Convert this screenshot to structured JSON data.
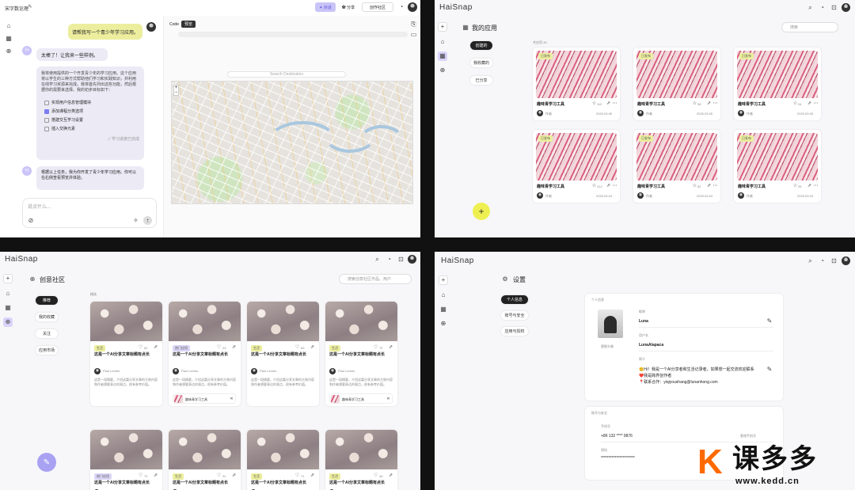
{
  "q1": {
    "title": "宋字数论理",
    "btn_active": "✦ 对话",
    "btn_share": "✿ 分享",
    "btn_community": "创作社区",
    "user_msg": "请帮我写一个青少年学习应用。",
    "bot_msg1": "太棒了！让我来一些样例。",
    "bot_para": "我将使用提供的一个开发青少年的学习应用。这个应用将以学生的三种方式帮助他们学习和实践知识，并利用在线学习资源来完成。我将首先列出这些功能，然后根据你的需要来选择。我的初步目标如下：",
    "tasks": [
      {
        "label": "实现用户信息管理模块",
        "done": false
      },
      {
        "label": "添加课程分类选项",
        "done": true
      },
      {
        "label": "搭建交互学习设置",
        "done": false
      },
      {
        "label": "插入交换元素",
        "done": false
      }
    ],
    "status": "✓ 学习进度已完成",
    "bot_msg2": "根据以上任务，我为你开发了青少年学习应用。你可以在右侧查看预览并体验。",
    "input_placeholder": "说点什么...",
    "tab_code": "Code",
    "tab_preview": "预览",
    "map_search": "Search Destination"
  },
  "q2": {
    "logo": "HaiSnap",
    "page_title": "我的应用",
    "search_placeholder": "搜索",
    "nav": [
      "创建的",
      "我收藏的",
      "已分享"
    ],
    "count_label": "共应用 45",
    "cards": [
      {
        "name": "趣味青学习工具",
        "tag": "已发布",
        "author": "作者",
        "likes": "112",
        "date": "2025.03.05"
      },
      {
        "name": "趣味青学习工具",
        "tag": "已发布",
        "author": "作者",
        "likes": "38",
        "date": "2025.03.05"
      },
      {
        "name": "趣味青学习工具",
        "tag": "已发布",
        "author": "作者",
        "likes": "24",
        "date": "2025.03.05"
      },
      {
        "name": "趣味青学习工具",
        "tag": "已发布",
        "author": "作者",
        "likes": "212",
        "date": "2025.03.04"
      },
      {
        "name": "趣味青学习工具",
        "tag": "已发布",
        "author": "作者",
        "likes": "82",
        "date": "2025.03.04"
      },
      {
        "name": "趣味青学习工具",
        "tag": "已发布",
        "author": "作者",
        "likes": "26",
        "date": "2025.03.03"
      }
    ],
    "fab": "+"
  },
  "q3": {
    "logo": "HaiSnap",
    "page_title": "创意社区",
    "search_placeholder": "搜索创意社区作品、用户",
    "nav": [
      "推荐",
      "我的收藏",
      "关注",
      "应用市场"
    ],
    "section": "精选",
    "posts": [
      {
        "tag": "生活",
        "title": "这是一个AI分享文章标题有点长",
        "author": "Paul Lemiro",
        "likes": "52",
        "body": "这是一段摘要，介绍这篇分享文章的大致内容和作者想要表达的观点，很有参考价值。",
        "app": ""
      },
      {
        "tag": "热门应用",
        "title": "这是一个AI分享文章标题有点长",
        "author": "Paul Lemiro",
        "likes": "23",
        "body": "这是一段摘要，介绍这篇分享文章的大致内容和作者想要表达的观点，很有参考价值。",
        "app": "趣味青学习工具"
      },
      {
        "tag": "生活",
        "title": "这是一个AI分享文章标题有点长",
        "author": "Paul Lemiro",
        "likes": "83",
        "body": "这是一段摘要，介绍这篇分享文章的大致内容和作者想要表达的观点，很有参考价值。",
        "app": ""
      },
      {
        "tag": "生活",
        "title": "这是一个AI分享文章标题有点长",
        "author": "Paul Lemiro",
        "likes": "72",
        "body": "这是一段摘要，介绍这篇分享文章的大致内容和作者想要表达的观点，很有参考价值。",
        "app": "趣味青学习工具"
      },
      {
        "tag": "热门应用",
        "title": "这是一个AI分享文章标题有点长",
        "author": "Paul Lemiro",
        "likes": "70",
        "body": "",
        "app": ""
      },
      {
        "tag": "生活",
        "title": "这是一个AI分享文章标题有点长",
        "author": "Paul Lemiro",
        "likes": "22",
        "body": "",
        "app": ""
      },
      {
        "tag": "生活",
        "title": "这是一个AI分享文章标题有点长",
        "author": "Paul Lemiro",
        "likes": "71",
        "body": "",
        "app": ""
      },
      {
        "tag": "生活",
        "title": "这是一个AI分享文章标题有点长",
        "author": "Paul Lemiro",
        "likes": "49",
        "body": "",
        "app": ""
      }
    ]
  },
  "q4": {
    "logo": "HaiSnap",
    "page_title": "设置",
    "nav": [
      "个人信息",
      "账号与安全",
      "应用与授权"
    ],
    "section_profile": "个人信息",
    "avatar_label": "更换头像",
    "label_name": "昵称",
    "name": "Luna",
    "label_username": "用户名",
    "username": "LunaAlapaca",
    "label_bio": "简介",
    "bio_lines": [
      "😊Hi！我是一个AI分享者和生活记录者，如果想一起交流欢迎联系",
      "❤️我是跨界创作者",
      "📍联系合作：yiqiyoushang@lunanhong.com"
    ],
    "section_security": "账号与安全",
    "label_phone": "手机号",
    "phone": "+86 132 **** 0876",
    "phone_action": "更改手机号",
    "label_password": "密码",
    "password": "**********************",
    "watermark": "课多多",
    "watermark_url": "www.kedd.cn"
  }
}
